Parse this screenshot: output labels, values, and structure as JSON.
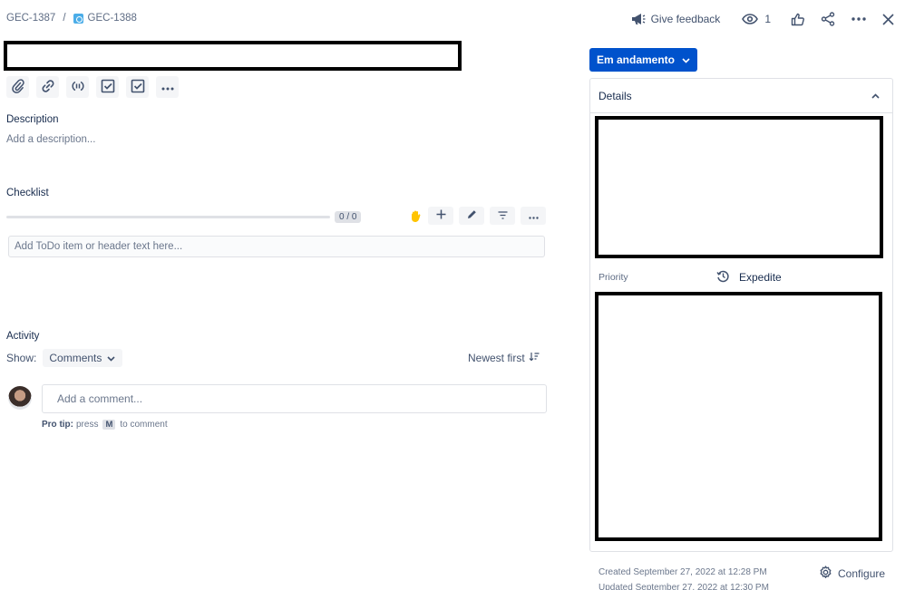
{
  "breadcrumb": {
    "parent": "GEC-1387",
    "separator": "/",
    "current": "GEC-1388"
  },
  "top_actions": {
    "feedback_label": "Give feedback",
    "watchers_count": "1"
  },
  "toolbar": {
    "icons": [
      "attachment-icon",
      "link-icon",
      "child-issue-icon",
      "checklist-icon",
      "checklist-icon",
      "more-icon"
    ]
  },
  "description": {
    "label": "Description",
    "placeholder": "Add a description..."
  },
  "checklist": {
    "label": "Checklist",
    "progress_text": "0 / 0",
    "progress_fraction": 0,
    "input_placeholder": "Add ToDo item or header text here..."
  },
  "activity": {
    "label": "Activity",
    "show_label": "Show:",
    "filter_value": "Comments",
    "sort_label": "Newest first",
    "comment_placeholder": "Add a comment...",
    "protip_bold": "Pro tip:",
    "protip_press": "press",
    "protip_key": "M",
    "protip_suffix": "to comment"
  },
  "status": {
    "label": "Em andamento",
    "color": "#0052cc"
  },
  "details": {
    "title": "Details",
    "priority_label": "Priority",
    "priority_value": "Expedite"
  },
  "footer": {
    "created": "Created September 27, 2022 at 12:28 PM",
    "updated": "Updated September 27, 2022 at 12:30 PM",
    "configure_label": "Configure"
  }
}
